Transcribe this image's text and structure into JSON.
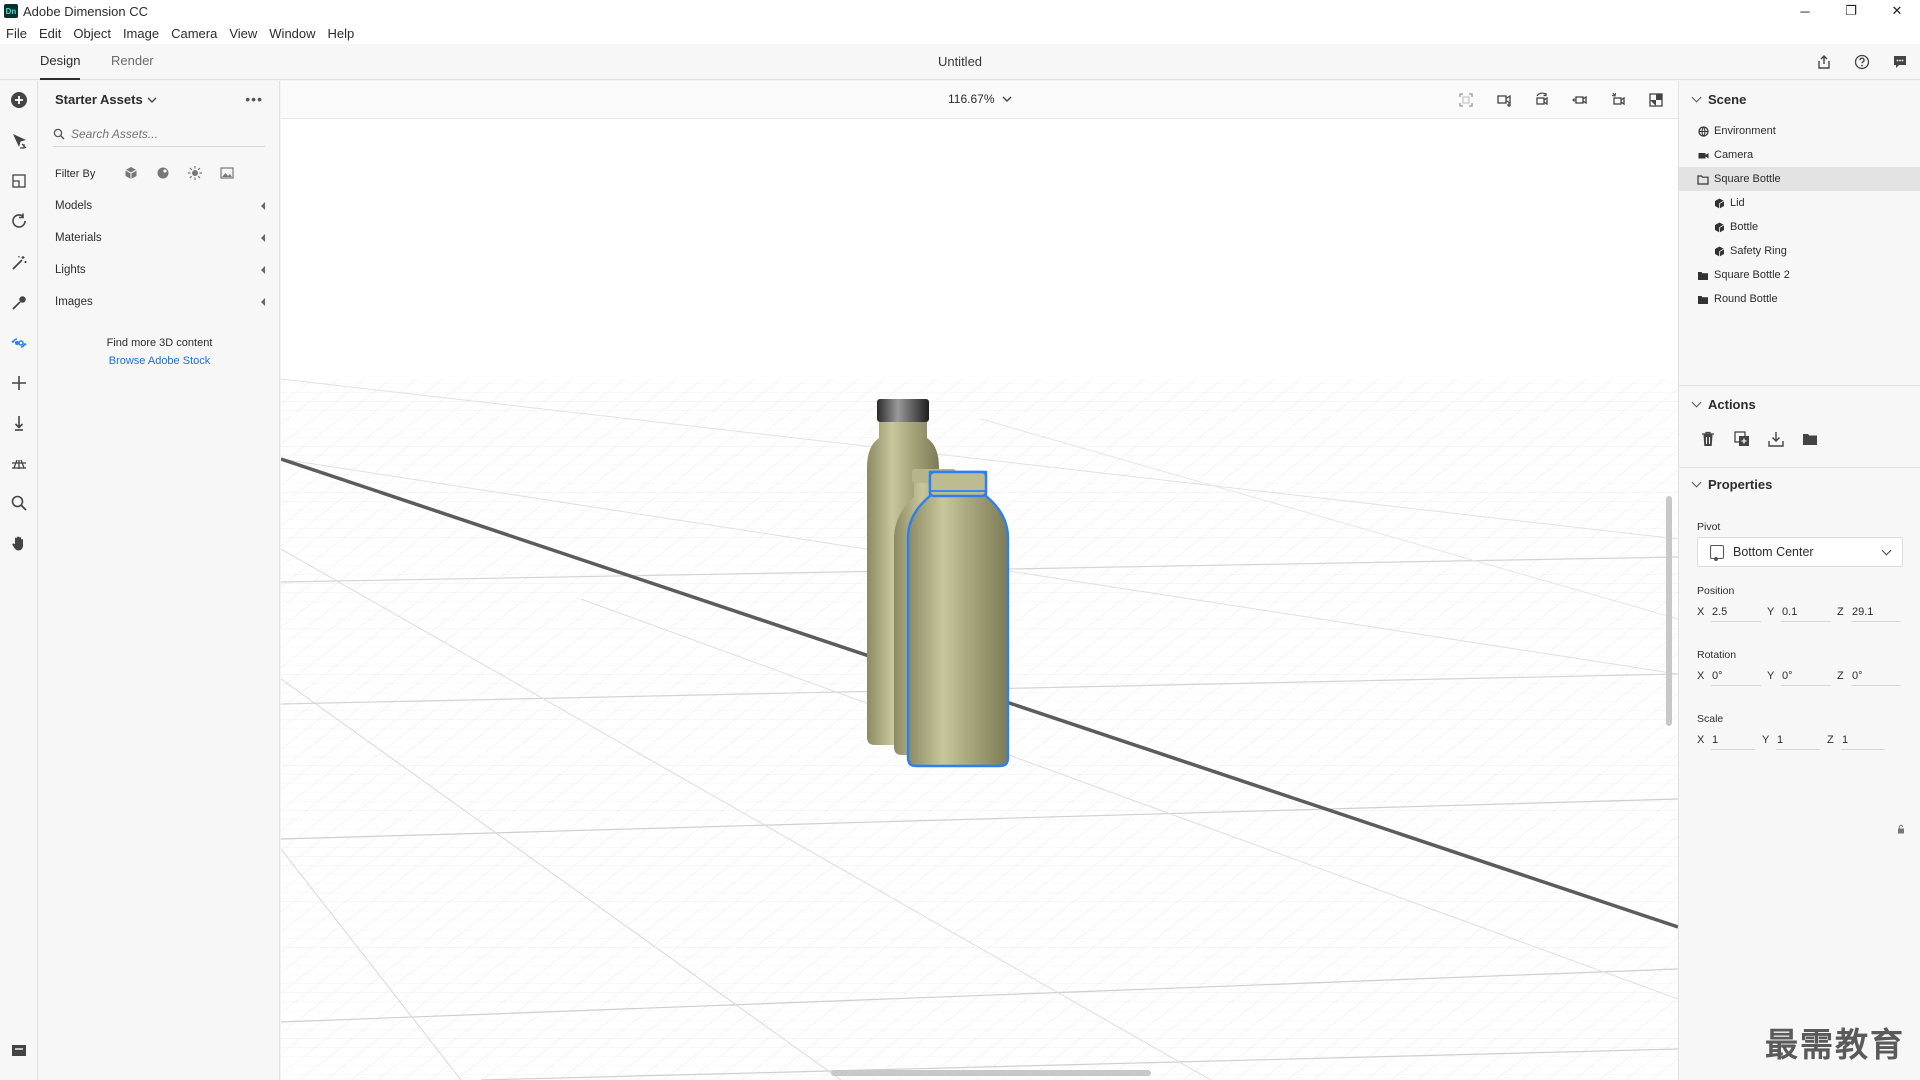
{
  "window": {
    "app_title": "Adobe Dimension CC",
    "app_icon_text": "Dn",
    "controls": {
      "minimize": "─",
      "restore": "❐",
      "close": "✕"
    }
  },
  "menu": [
    "File",
    "Edit",
    "Object",
    "Image",
    "Camera",
    "View",
    "Window",
    "Help"
  ],
  "workspace": {
    "tabs": [
      "Design",
      "Render"
    ],
    "active_tab": "Design",
    "document_title": "Untitled"
  },
  "tools": [
    "add-icon",
    "select-icon",
    "sample-icon",
    "orbit-icon",
    "magic-wand-icon",
    "eyedropper-icon",
    "link-icon",
    "move-icon",
    "drop-icon",
    "horizon-icon",
    "zoom-icon",
    "hand-icon",
    "layers-icon"
  ],
  "assets": {
    "header": "Starter Assets",
    "search_placeholder": "Search Assets...",
    "filter_label": "Filter By",
    "categories": [
      "Models",
      "Materials",
      "Lights",
      "Images"
    ],
    "find_more": "Find more 3D content",
    "browse_link": "Browse Adobe Stock"
  },
  "viewport": {
    "zoom": "116.67%",
    "selection_color": "#2d7ff0",
    "bottle_color": "#aaa87e"
  },
  "scene": {
    "title": "Scene",
    "items": [
      {
        "label": "Environment",
        "icon": "environment-icon",
        "level": 0,
        "selected": false
      },
      {
        "label": "Camera",
        "icon": "camera-icon",
        "level": 0,
        "selected": false
      },
      {
        "label": "Square Bottle",
        "icon": "folder-open-icon",
        "level": 0,
        "selected": true
      },
      {
        "label": "Lid",
        "icon": "model-icon",
        "level": 1,
        "selected": false
      },
      {
        "label": "Bottle",
        "icon": "model-icon",
        "level": 1,
        "selected": false
      },
      {
        "label": "Safety Ring",
        "icon": "model-icon",
        "level": 1,
        "selected": false
      },
      {
        "label": "Square Bottle 2",
        "icon": "folder-icon",
        "level": 0,
        "selected": false
      },
      {
        "label": "Round Bottle",
        "icon": "folder-icon",
        "level": 0,
        "selected": false
      }
    ]
  },
  "actions": {
    "title": "Actions",
    "items": [
      "delete-icon",
      "duplicate-icon",
      "download-icon",
      "group-icon"
    ]
  },
  "properties": {
    "title": "Properties",
    "pivot_label": "Pivot",
    "pivot_value": "Bottom Center",
    "position_label": "Position",
    "position": {
      "x": "2.5",
      "y": "0.1",
      "z": "29.1"
    },
    "rotation_label": "Rotation",
    "rotation": {
      "x": "0°",
      "y": "0°",
      "z": "0°"
    },
    "scale_label": "Scale",
    "scale": {
      "x": "1",
      "y": "1",
      "z": "1"
    }
  },
  "watermark": "最需教育"
}
